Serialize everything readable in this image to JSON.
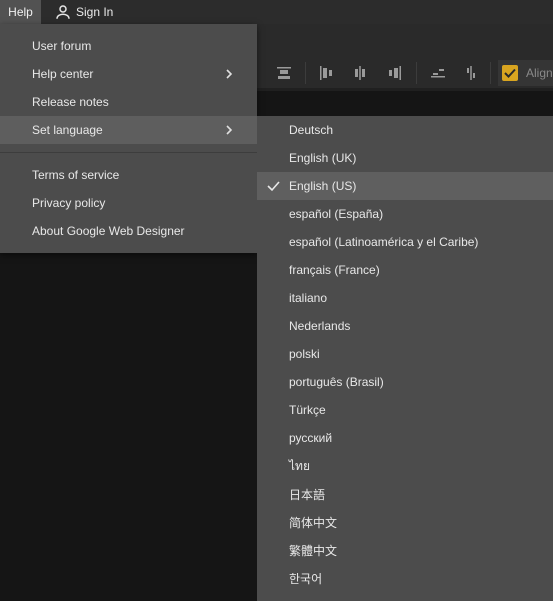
{
  "menubar": {
    "help_label": "Help",
    "signin_label": "Sign In",
    "signin_icon": "person-icon"
  },
  "toolbar": {
    "align_label": "Align",
    "align_checked": true,
    "accent_color": "#d9a520"
  },
  "help_menu": {
    "items": [
      {
        "label": "User forum",
        "has_submenu": false
      },
      {
        "label": "Help center",
        "has_submenu": true
      },
      {
        "label": "Release notes",
        "has_submenu": false
      },
      {
        "label": "Set language",
        "has_submenu": true,
        "active": true
      },
      {
        "label": "Terms of service",
        "has_submenu": false
      },
      {
        "label": "Privacy policy",
        "has_submenu": false
      },
      {
        "label": "About Google Web Designer",
        "has_submenu": false
      }
    ]
  },
  "language_menu": {
    "selected": "English (US)",
    "items": [
      "Deutsch",
      "English (UK)",
      "English (US)",
      "español (España)",
      "español (Latinoamérica y el Caribe)",
      "français (France)",
      "italiano",
      "Nederlands",
      "polski",
      "português (Brasil)",
      "Türkçe",
      "русский",
      "ไทย",
      "日本語",
      "简体中文",
      "繁體中文",
      "한국어"
    ]
  }
}
